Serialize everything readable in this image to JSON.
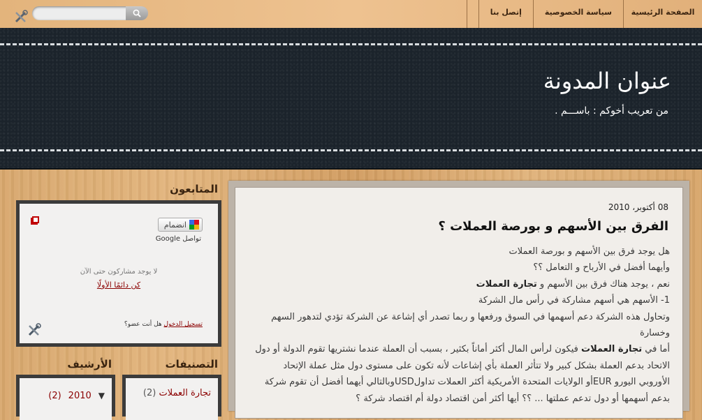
{
  "nav": {
    "items": [
      "الصفحة الرئيسية",
      "سياسة الخصوصية",
      "إتصل بنا"
    ]
  },
  "search": {
    "placeholder": ""
  },
  "header": {
    "title": "عنوان المدونة",
    "description": "من تعريب أخوكم : باســـم ."
  },
  "post": {
    "date": "08 أكتوبر، 2010",
    "title": "الفرق بين الأسهم و بورصة العملات ؟",
    "paragraphs": [
      "هل يوجد فرق بين الأسهم و بورصة العملات",
      "وأيهما أفضل في الأرباح و التعامل ؟؟",
      "نعم ، يوجد هناك فرق بين الأسهم و تجارة العملات",
      "1- الأسهم هي أسهم مشاركة في رأس مال الشركة",
      "وتحاول هذه الشركة دعم أسهمها في السوق ورفعها و ربما تصدر أي إشاعة عن الشركة تؤدي لتدهور السهم وخسارة",
      "أما في تجارة العملات فيكون لرأس المال أكثر أماناً بكثير ، بسبب أن العملة عندما نشتريها تقوم الدولة أو دول الاتحاد بدعم العملة بشكل كبير ولا تتأثر العملة بأي إشاعات لأنه تكون على مستوى دول مثل عملة الإتحاد الأوروبي اليورو EURأو الولايات المتحدة الأمريكية أكثر العملات تداولUSDوبالتالي أيهما أفضل أن تقوم شركة بدعم أسهمها أو دول تدعم عملتها ... ؟؟ أيها أكثر أمن اقتصاد دولة أم اقتصاد شركة ؟"
    ],
    "bold_phrase": "تجارة العملات"
  },
  "followers": {
    "title": "المتابعون",
    "join_label": "انضمام",
    "gfc_label": "Google تواصل",
    "no_followers": "لا يوجد مشاركون حتى الآن",
    "be_first": "كن دائمًا الأولًا",
    "member_question": "هل أنت عضو؟",
    "login": "تسجيل الدخول"
  },
  "archive": {
    "title": "الأرشيف",
    "year": "2010",
    "count": "(2)"
  },
  "categories": {
    "title": "التصنيفات",
    "items": [
      {
        "label": "تجارة العملات",
        "count": "(2)"
      }
    ]
  },
  "colors": {
    "header_bg": "#1b232b",
    "link_red": "#8b0000",
    "post_bg": "#f1eeea"
  },
  "icons": [
    "tools-icon",
    "search-icon",
    "google-friend-connect-icon",
    "red-windows-icon"
  ]
}
